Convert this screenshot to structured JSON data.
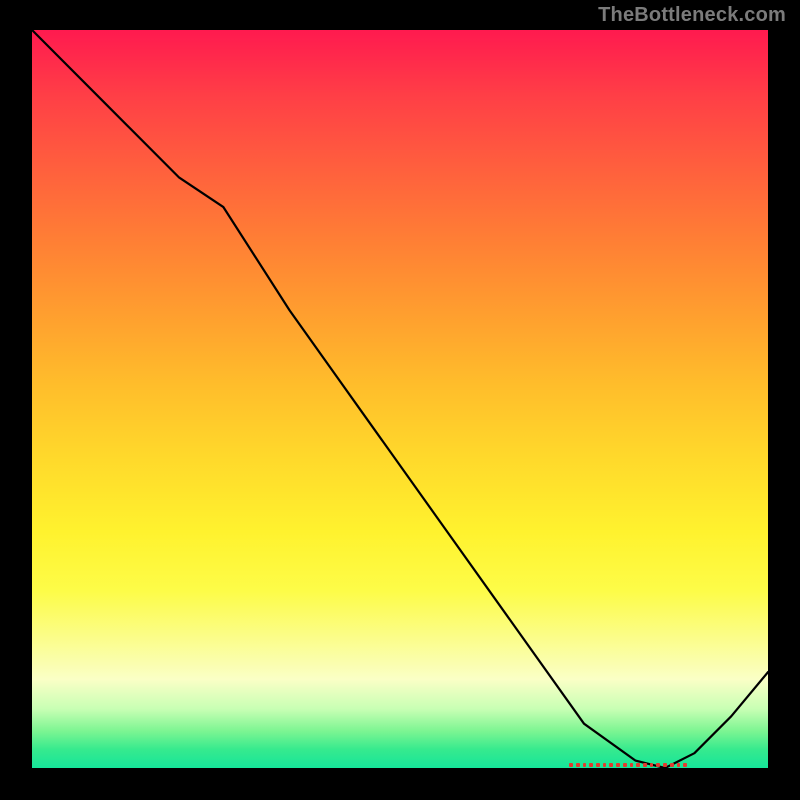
{
  "attribution": "TheBottleneck.com",
  "colors": {
    "page_bg": "#000000",
    "text_muted": "#7b7b7b",
    "curve": "#000000",
    "marker": "#e03c30"
  },
  "chart_data": {
    "type": "line",
    "title": "",
    "xlabel": "",
    "ylabel": "",
    "xlim": [
      0,
      100
    ],
    "ylim": [
      0,
      100
    ],
    "grid": false,
    "legend": "none",
    "x": [
      0,
      10,
      20,
      26,
      35,
      45,
      55,
      65,
      75,
      82,
      86,
      90,
      95,
      100
    ],
    "values": [
      100,
      90,
      80,
      76,
      62,
      48,
      34,
      20,
      6,
      1,
      0,
      2,
      7,
      13
    ],
    "minimum_x": 86,
    "optimal_range_x": [
      73,
      89
    ],
    "gradient_stops": [
      {
        "pos": 0.0,
        "color": "#ff1a4f"
      },
      {
        "pos": 0.5,
        "color": "#ffd92b"
      },
      {
        "pos": 0.88,
        "color": "#faffc6"
      },
      {
        "pos": 1.0,
        "color": "#16e59a"
      }
    ]
  },
  "marker": {
    "dot_count": 18
  }
}
